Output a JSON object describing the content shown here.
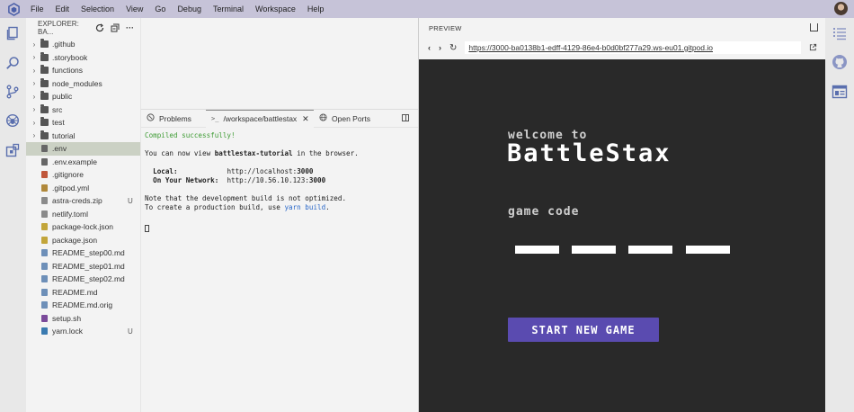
{
  "menubar": {
    "items": [
      "File",
      "Edit",
      "Selection",
      "View",
      "Go",
      "Debug",
      "Terminal",
      "Workspace",
      "Help"
    ]
  },
  "activity_left": [
    "files-icon",
    "search-icon",
    "source-control-icon",
    "debug-icon",
    "extensions-icon"
  ],
  "explorer": {
    "title": "EXPLORER: BA...",
    "items": [
      {
        "label": ".github",
        "type": "folder",
        "badge": ""
      },
      {
        "label": ".storybook",
        "type": "folder",
        "badge": ""
      },
      {
        "label": "functions",
        "type": "folder",
        "badge": ""
      },
      {
        "label": "node_modules",
        "type": "folder",
        "badge": ""
      },
      {
        "label": "public",
        "type": "folder",
        "badge": ""
      },
      {
        "label": "src",
        "type": "folder",
        "badge": ""
      },
      {
        "label": "test",
        "type": "folder",
        "badge": ""
      },
      {
        "label": "tutorial",
        "type": "folder",
        "badge": ""
      },
      {
        "label": ".env",
        "type": "gear",
        "badge": ""
      },
      {
        "label": ".env.example",
        "type": "gear",
        "badge": ""
      },
      {
        "label": ".gitignore",
        "type": "git",
        "badge": ""
      },
      {
        "label": ".gitpod.yml",
        "type": "yml",
        "badge": ""
      },
      {
        "label": "astra-creds.zip",
        "type": "zip",
        "badge": "U"
      },
      {
        "label": "netlify.toml",
        "type": "toml",
        "badge": ""
      },
      {
        "label": "package-lock.json",
        "type": "json",
        "badge": ""
      },
      {
        "label": "package.json",
        "type": "json",
        "badge": ""
      },
      {
        "label": "README_step00.md",
        "type": "md",
        "badge": ""
      },
      {
        "label": "README_step01.md",
        "type": "md",
        "badge": ""
      },
      {
        "label": "README_step02.md",
        "type": "md",
        "badge": ""
      },
      {
        "label": "README.md",
        "type": "md",
        "badge": ""
      },
      {
        "label": "README.md.orig",
        "type": "md",
        "badge": ""
      },
      {
        "label": "setup.sh",
        "type": "sh",
        "badge": ""
      },
      {
        "label": "yarn.lock",
        "type": "yarn",
        "badge": "U"
      }
    ],
    "selected": ".env"
  },
  "panel": {
    "tabs": [
      {
        "label": "Problems",
        "icon": "circle"
      },
      {
        "label": "/workspace/battlestax",
        "icon": ">_"
      },
      {
        "label": "Open Ports",
        "icon": "globe"
      }
    ],
    "active_tab": "/workspace/battlestax",
    "terminal": {
      "line1": "Compiled successfully!",
      "line2_prefix": "You can now view ",
      "line2_app": "battlestax-tutorial",
      "line2_suffix": " in the browser.",
      "local_label": "  Local:",
      "local_url_prefix": "http://localhost:",
      "local_port": "3000",
      "network_label": "  On Your Network:",
      "network_url_prefix": "http://10.56.10.123:",
      "network_port": "3000",
      "note1": "Note that the development build is not optimized.",
      "note2_prefix": "To create a production build, use ",
      "note2_cmd": "yarn build",
      "note2_suffix": "."
    }
  },
  "preview": {
    "title": "PREVIEW",
    "url": "https://3000-ba0138b1-edff-4129-86e4-b0d0bf277a29.ws-eu01.gitpod.io",
    "game": {
      "welcome": "welcome to",
      "title": "BattleStax",
      "game_code_label": "game code",
      "code_boxes": 4,
      "start_button": "START NEW GAME"
    }
  },
  "activity_right": [
    "outline-icon",
    "github-icon",
    "preview-icon"
  ],
  "colors": {
    "menubar": "#c6c3d8",
    "game_bg": "#292929",
    "start_button": "#5a4bb0",
    "terminal_green": "#3f9c35",
    "terminal_link": "#2a68c8"
  }
}
